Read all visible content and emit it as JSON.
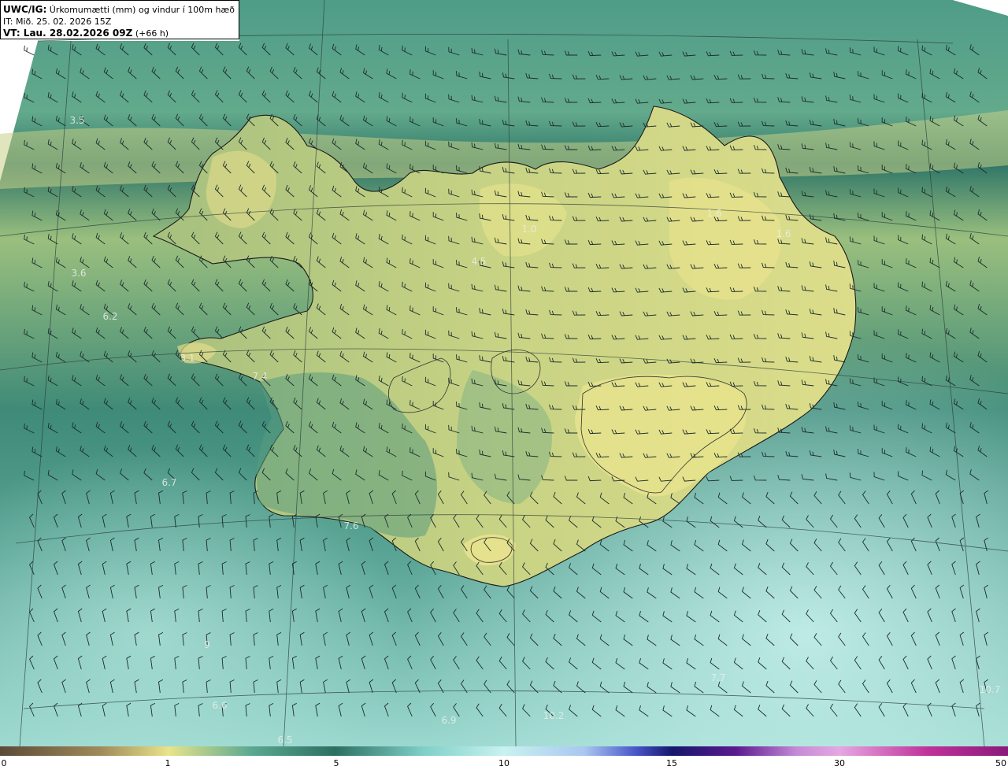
{
  "header": {
    "line1_prefix": "UWC/IG:",
    "line1_text": "Úrkomumætti (mm) og vindur í 100m hæð",
    "line2": "IT: Mið. 25. 02. 2026 15Z",
    "line3_prefix": "VT: Lau. 28.02.2026 09Z",
    "line3_suffix": "(+66 h)"
  },
  "map_labels": [
    {
      "id": "v01",
      "text": "3.5"
    },
    {
      "id": "v02",
      "text": "3.6"
    },
    {
      "id": "v03",
      "text": "6.2"
    },
    {
      "id": "v04",
      "text": "3.1"
    },
    {
      "id": "v05",
      "text": "7.4"
    },
    {
      "id": "v06",
      "text": "4.5"
    },
    {
      "id": "v07",
      "text": "1.0"
    },
    {
      "id": "v08",
      "text": "1.6"
    },
    {
      "id": "v09",
      "text": "1.6"
    },
    {
      "id": "v10",
      "text": "6.7"
    },
    {
      "id": "v11",
      "text": "7.6"
    },
    {
      "id": "v12",
      "text": "6.6"
    },
    {
      "id": "v13",
      "text": "6.9"
    },
    {
      "id": "v14",
      "text": "6.5"
    },
    {
      "id": "v15",
      "text": "10.2"
    },
    {
      "id": "v16",
      "text": "7.7"
    },
    {
      "id": "v17",
      "text": "10.7"
    },
    {
      "id": "v18",
      "text": "9"
    }
  ],
  "colorbar": {
    "ticks": [
      "0",
      "1",
      "5",
      "10",
      "15",
      "30",
      "50"
    ],
    "colors": [
      "#5b4a37",
      "#a08a5a",
      "#e8e48a",
      "#5aa890",
      "#2c6f62",
      "#7fd0c8",
      "#c8f2f0",
      "#a9c7f0",
      "#4a56c9",
      "#15176b",
      "#5b1a8f",
      "#c48ad6",
      "#e6a7e2",
      "#c0329a",
      "#8a1a7a"
    ]
  },
  "colors": {
    "dry": "#e6e28c",
    "moderate": "#5ba68c",
    "wet": "#2f7466",
    "very_wet": "#bff0ec",
    "coast": "#1a1a1a"
  }
}
